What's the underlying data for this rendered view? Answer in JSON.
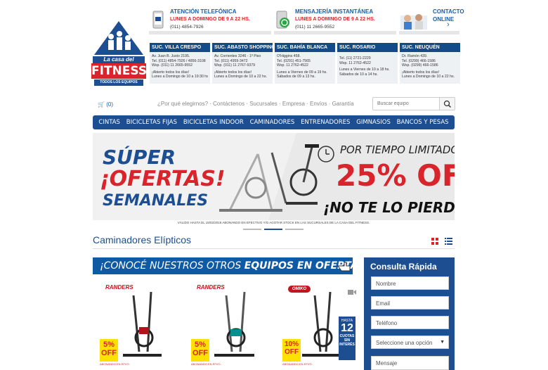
{
  "header": {
    "logo_text": {
      "top": "La casa del",
      "main": "FITNESS",
      "bottom": "TODOS LOS EQUIPOS"
    },
    "contacts": [
      {
        "title": "ATENCIÓN TELEFÓNICA",
        "hours": "LUNES A DOMINGO DE 9 A 22 HS.",
        "number": "(011) 4854-7926"
      },
      {
        "title": "MENSAJERÍA INSTANTÁNEA",
        "hours": "LUNES A DOMINGO DE 9 A 22 HS.",
        "number": "(011) 11 2665-9552"
      },
      {
        "title": "CONTACTO",
        "sub": "ONLINE",
        "arrow": "›"
      }
    ]
  },
  "stores": [
    {
      "name": "SUC. VILLA CRESPO",
      "lines": [
        "Av. Juan B. Justo 2195.",
        "Tel. (011) 4854-7926 / 4856-3108",
        "Wsp. (011) 11 2665-9552",
        "",
        "¡Abierto todos los días!",
        "Lunes a Domingo de 10 a 19:30 hs."
      ]
    },
    {
      "name": "SUC. ABASTO SHOPPING",
      "lines": [
        "Av. Corrientes 3246 - 1º Piso",
        "Tel. (011) 4959-3472",
        "Wsp. (011) 11 2767-9379",
        "",
        "¡Abierto todos los días!",
        "Lunes a Domingo de 10 a 22 hs."
      ]
    },
    {
      "name": "SUC. BAHÍA BLANCA",
      "lines": [
        "O'Higgins 458.",
        "Tel. (0291) 451-7565",
        "Wsp. 11 2762-4522",
        "",
        "Lunes a Viernes de 09 a 19 hs.",
        "Sábados de 09 a 13 hs."
      ]
    },
    {
      "name": "SUC. ROSARIO",
      "lines": [
        "",
        "Tel. (11) 2721-2229",
        "Wsp. 11 2762-4522",
        "",
        "Lunes a Viernes de 10 a 18 hs.",
        "Sábados de 10 a 14 hs."
      ]
    },
    {
      "name": "SUC. NEUQUÉN",
      "lines": [
        "Dr. Ramón 439.",
        "Tel. (0299) 466-1586",
        "Wsp. (0299) 466-1586",
        "",
        "¡Abierto todos los días!",
        "Lunes a Domingo de 10 a 22 hs."
      ]
    }
  ],
  "cart": {
    "count": "(0)"
  },
  "top_links": [
    "¿Por qué elegirnos?",
    "Contáctenos",
    "Sucursales",
    "Empresa",
    "Envíos",
    "Garantía"
  ],
  "search": {
    "placeholder": "Buscar equipo"
  },
  "nav": [
    "CINTAS",
    "BICICLETAS FIJAS",
    "BICICLETAS INDOOR",
    "CAMINADORES",
    "ENTRENADORES",
    "GIMNASIOS",
    "BANCOS Y PESAS"
  ],
  "banner": {
    "l1": "SÚPER",
    "l2": "¡OFERTAS!",
    "l3": "SEMANALES",
    "r1": "POR TIEMPO LIMITADO",
    "r2": "25% OFF",
    "r3": "¡NO TE LO PIERDAS!",
    "footnote": "VÁLIDO HASTA EL 15/02/2018 ABONANDO EN EFECTIVO Y/O AGOTAR STOCK EN LAS SUCURSALES DE LA CASA DEL FITNESS."
  },
  "section": {
    "title": "Caminadores Elípticos"
  },
  "offer_bar": {
    "pre": "¡CONOCÉ NUESTROS OTROS",
    "bold": "EQUIPOS EN OFERTA!"
  },
  "quick_form": {
    "title": "Consulta Rápida",
    "fields": [
      "Nombre",
      "Email",
      "Teléfono"
    ],
    "select": "Seleccione una opción",
    "message": "Mensaje"
  },
  "products": [
    {
      "brand": "RANDERS",
      "badge": "5%",
      "badge2": "OFF",
      "badge_small": "ABONANDO EN EFVO."
    },
    {
      "brand": "RANDERS",
      "badge": "5%",
      "badge2": "OFF",
      "badge_small": "ABONANDO EN EFVO."
    },
    {
      "brand": "OMIKO",
      "badge": "10%",
      "badge2": "OFF",
      "badge_small": "ABONANDO EN EFVO.",
      "promo": [
        "HASTA",
        "12",
        "CUOTAS",
        "SIN",
        "INTERÉS"
      ]
    }
  ],
  "colors": {
    "brand_blue": "#1c4e91",
    "accent_red": "#d8242a",
    "offer_blue": "#0f5aa5"
  }
}
